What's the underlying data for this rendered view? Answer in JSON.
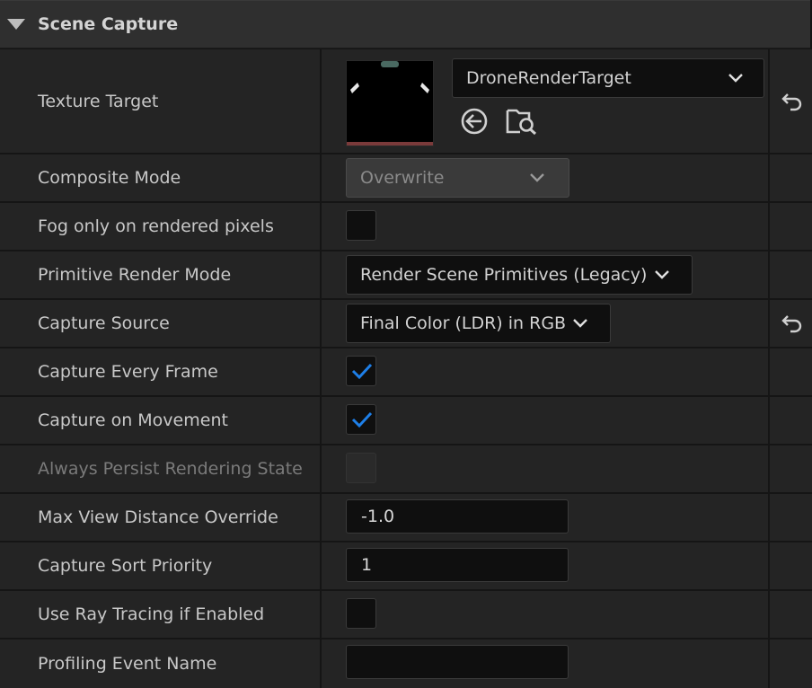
{
  "section": {
    "title": "Scene Capture"
  },
  "rows": {
    "texture_target": {
      "label": "Texture Target",
      "value": "DroneRenderTarget"
    },
    "composite_mode": {
      "label": "Composite Mode",
      "value": "Overwrite"
    },
    "fog": {
      "label": "Fog only on rendered pixels",
      "checked": false
    },
    "primitive_render_mode": {
      "label": "Primitive Render Mode",
      "value": "Render Scene Primitives (Legacy)"
    },
    "capture_source": {
      "label": "Capture Source",
      "value": "Final Color (LDR) in RGB"
    },
    "capture_every_frame": {
      "label": "Capture Every Frame",
      "checked": true
    },
    "capture_on_movement": {
      "label": "Capture on Movement",
      "checked": true
    },
    "always_persist": {
      "label": "Always Persist Rendering State",
      "checked": false,
      "disabled": true
    },
    "max_view_distance": {
      "label": "Max View Distance Override",
      "value": "-1.0"
    },
    "capture_sort_priority": {
      "label": "Capture Sort Priority",
      "value": "1"
    },
    "ray_tracing": {
      "label": "Use Ray Tracing if Enabled",
      "checked": false
    },
    "profiling_event_name": {
      "label": "Profiling Event Name",
      "value": ""
    }
  },
  "icons": {
    "reset": "reset-to-default-icon",
    "use_selected": "use-selected-asset-icon",
    "browse": "browse-asset-icon"
  },
  "colors": {
    "check": "#1e7fe8",
    "background": "#242424"
  }
}
